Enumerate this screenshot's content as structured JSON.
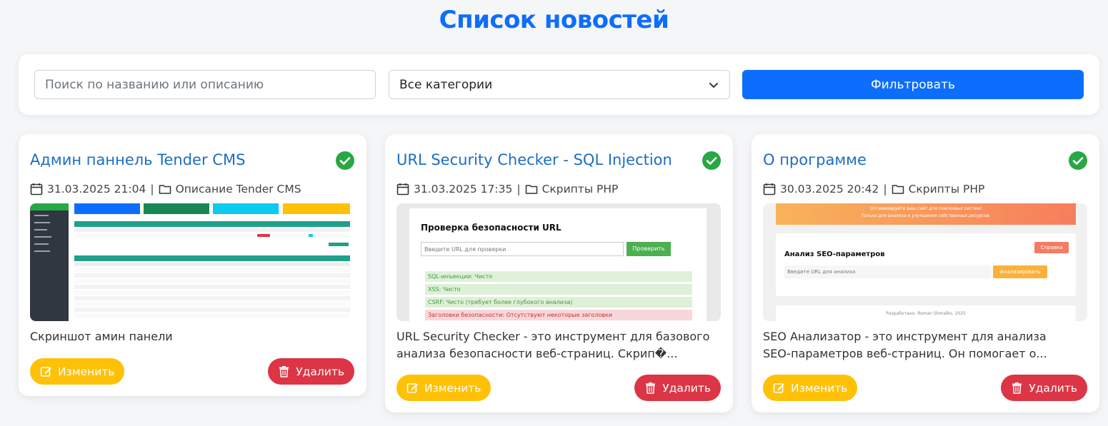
{
  "page": {
    "title": "Список новостей"
  },
  "filters": {
    "search_placeholder": "Поиск по названию или описанию",
    "search_value": "",
    "category_selected": "Все категории",
    "filter_label": "Фильтровать"
  },
  "colors": {
    "primary": "#0d6efd",
    "title_link": "#1b6ec2",
    "success": "#28a745",
    "warning": "#ffc107",
    "danger": "#dc3545"
  },
  "cards": [
    {
      "title": "Админ паннель Tender CMS",
      "date": "31.03.2025 21:04",
      "category": "Описание Tender CMS",
      "description": "Скриншот амин панели",
      "edit_label": "Изменить",
      "delete_label": "Удалить",
      "status_icon": "check-circle-icon"
    },
    {
      "title": "URL Security Checker - SQL Injection",
      "date": "31.03.2025 17:35",
      "category": "Скрипты PHP",
      "description": "URL Security Checker - это инструмент для базового анализа безопасности веб-страниц. Скрип�...",
      "edit_label": "Изменить",
      "delete_label": "Удалить",
      "status_icon": "check-circle-icon",
      "thumb": {
        "heading": "Проверка безопасности URL",
        "input_placeholder": "Введите URL для проверки",
        "button_label": "Проверить",
        "results": [
          "SQL-инъекции: Чисто",
          "XSS: Чисто",
          "CSRF: Чисто (требует более глубокого анализа)",
          "Заголовки безопасности: Отсутствуют некоторые заголовки"
        ]
      }
    },
    {
      "title": "О программе",
      "date": "30.03.2025 20:42",
      "category": "Скрипты PHP",
      "description": "SEO Анализатор - это инструмент для анализа SEO-параметров веб-страниц. Он помогает о...",
      "edit_label": "Изменить",
      "delete_label": "Удалить",
      "status_icon": "check-circle-icon",
      "thumb": {
        "banner_line1": "Оптимизируйте ваш сайт для поисковых систем!",
        "banner_line2": "Только для анализа и улучшения собственных ресурсов.",
        "heading": "Анализ SEO-параметров",
        "help_label": "Справка",
        "input_placeholder": "Введите URL для анализа",
        "button_label": "Анализировать",
        "footer": "Разработано: Roman Shmalko, 2025"
      }
    }
  ]
}
